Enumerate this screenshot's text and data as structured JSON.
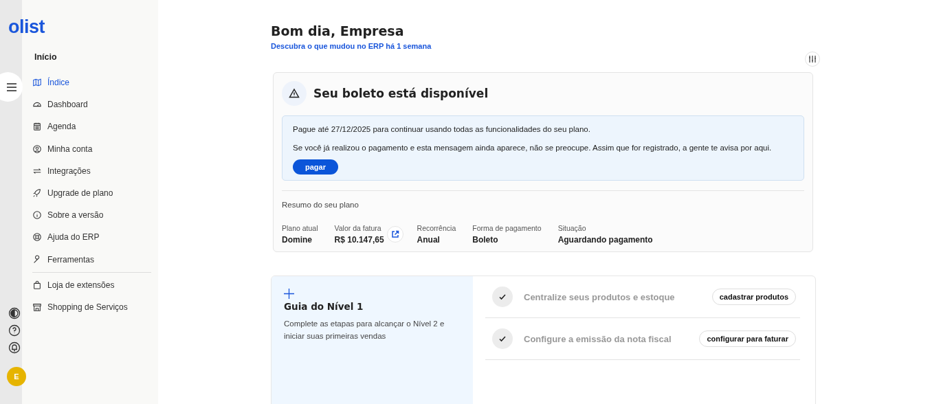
{
  "logo": "olist",
  "sidebar": {
    "section": "Início",
    "items": [
      {
        "label": "Índice",
        "selected": true
      },
      {
        "label": "Dashboard",
        "selected": false
      },
      {
        "label": "Agenda",
        "selected": false
      },
      {
        "label": "Minha conta",
        "selected": false
      },
      {
        "label": "Integrações",
        "selected": false
      },
      {
        "label": "Upgrade de plano",
        "selected": false
      },
      {
        "label": "Sobre a versão",
        "selected": false
      },
      {
        "label": "Ajuda do ERP",
        "selected": false
      },
      {
        "label": "Ferramentas",
        "selected": false
      }
    ],
    "extra_items": [
      {
        "label": "Loja de extensões",
        "selected": false
      },
      {
        "label": "Shopping de Serviços",
        "selected": false
      }
    ]
  },
  "rail": {
    "avatar": "E"
  },
  "greeting": {
    "title": "Bom dia, Empresa",
    "link": "Descubra o que mudou no ERP há 1 semana"
  },
  "boleto": {
    "title": "Seu boleto está disponível",
    "notice": [
      "Pague até 27/12/2025 para continuar usando todas as funcionalidades do seu plano.",
      "Se você já realizou o pagamento e esta mensagem ainda aparece, não se preocupe. Assim que for registrado, a gente te avisa por aqui."
    ],
    "button": "pagar",
    "summary_title": "Resumo do seu plano",
    "fields": [
      {
        "label": "Plano atual",
        "value": "Domine",
        "kind": "plain"
      },
      {
        "label": "Valor da fatura",
        "value": "R$ 10.147,65",
        "kind": "linked"
      },
      {
        "label": "Recorrência",
        "value": "Anual",
        "kind": "plain"
      },
      {
        "label": "Forma de pagamento",
        "value": "Boleto",
        "kind": "plain"
      },
      {
        "label": "Situação",
        "value": "Aguardando pagamento",
        "kind": "plain"
      }
    ]
  },
  "guide": {
    "title": "Guia do Nível 1",
    "description": "Complete as etapas para alcançar o Nível 2 e iniciar suas primeiras vendas",
    "steps": [
      {
        "label": "Centralize seus produtos e estoque",
        "done": true,
        "button": "cadastrar produtos"
      },
      {
        "label": "Configure a emissão da nota fiscal",
        "done": true,
        "button": "configurar para faturar"
      }
    ]
  }
}
